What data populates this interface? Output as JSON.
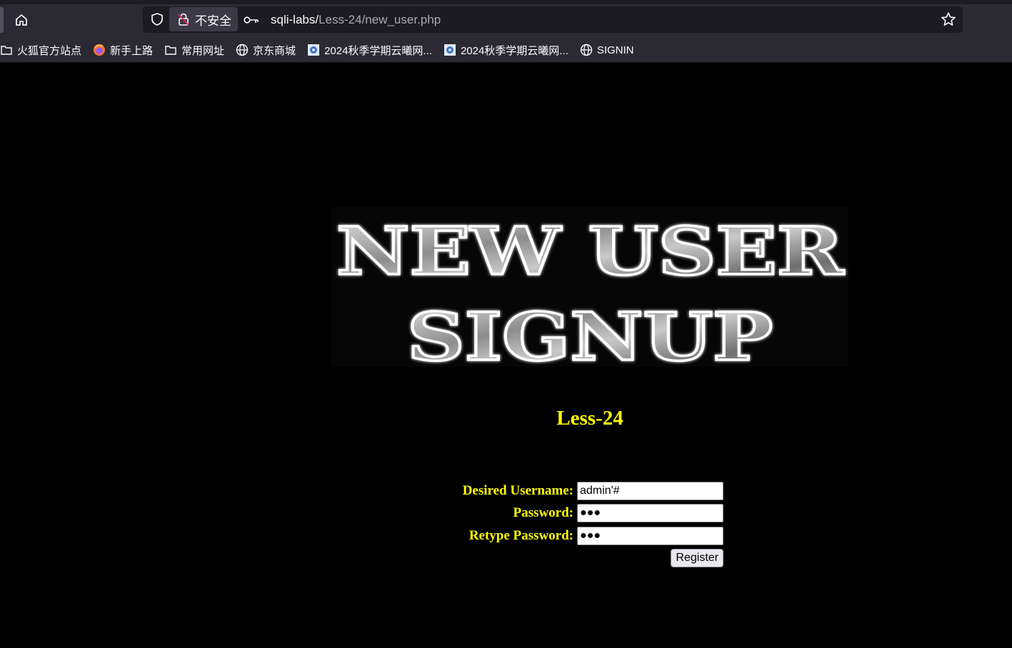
{
  "browser": {
    "security_label": "不安全",
    "url_host": "sqli-labs/",
    "url_path": "Less-24/new_user.php",
    "bookmarks": [
      {
        "label": "火狐官方站点",
        "icon": "folder-icon"
      },
      {
        "label": "新手上路",
        "icon": "firefox-icon"
      },
      {
        "label": "常用网址",
        "icon": "folder-icon"
      },
      {
        "label": "京东商城",
        "icon": "globe-icon"
      },
      {
        "label": "2024秋季学期云曦网...",
        "icon": "site-favicon"
      },
      {
        "label": "2024秋季学期云曦网...",
        "icon": "site-favicon"
      },
      {
        "label": "SIGNIN",
        "icon": "globe-icon"
      }
    ]
  },
  "page": {
    "banner_line1": "NEW USER",
    "banner_line2": "SIGNUP",
    "title": "Less-24",
    "form": {
      "username_label": "Desired Username:",
      "username_value": "admin'#",
      "password_label": "Password:",
      "password_value": "●●●",
      "retype_label": "Retype Password:",
      "retype_value": "●●●",
      "register_label": "Register"
    }
  },
  "colors": {
    "page_bg": "#000000",
    "label_yellow": "#ffff00",
    "chrome_bg": "#2b2a33"
  }
}
